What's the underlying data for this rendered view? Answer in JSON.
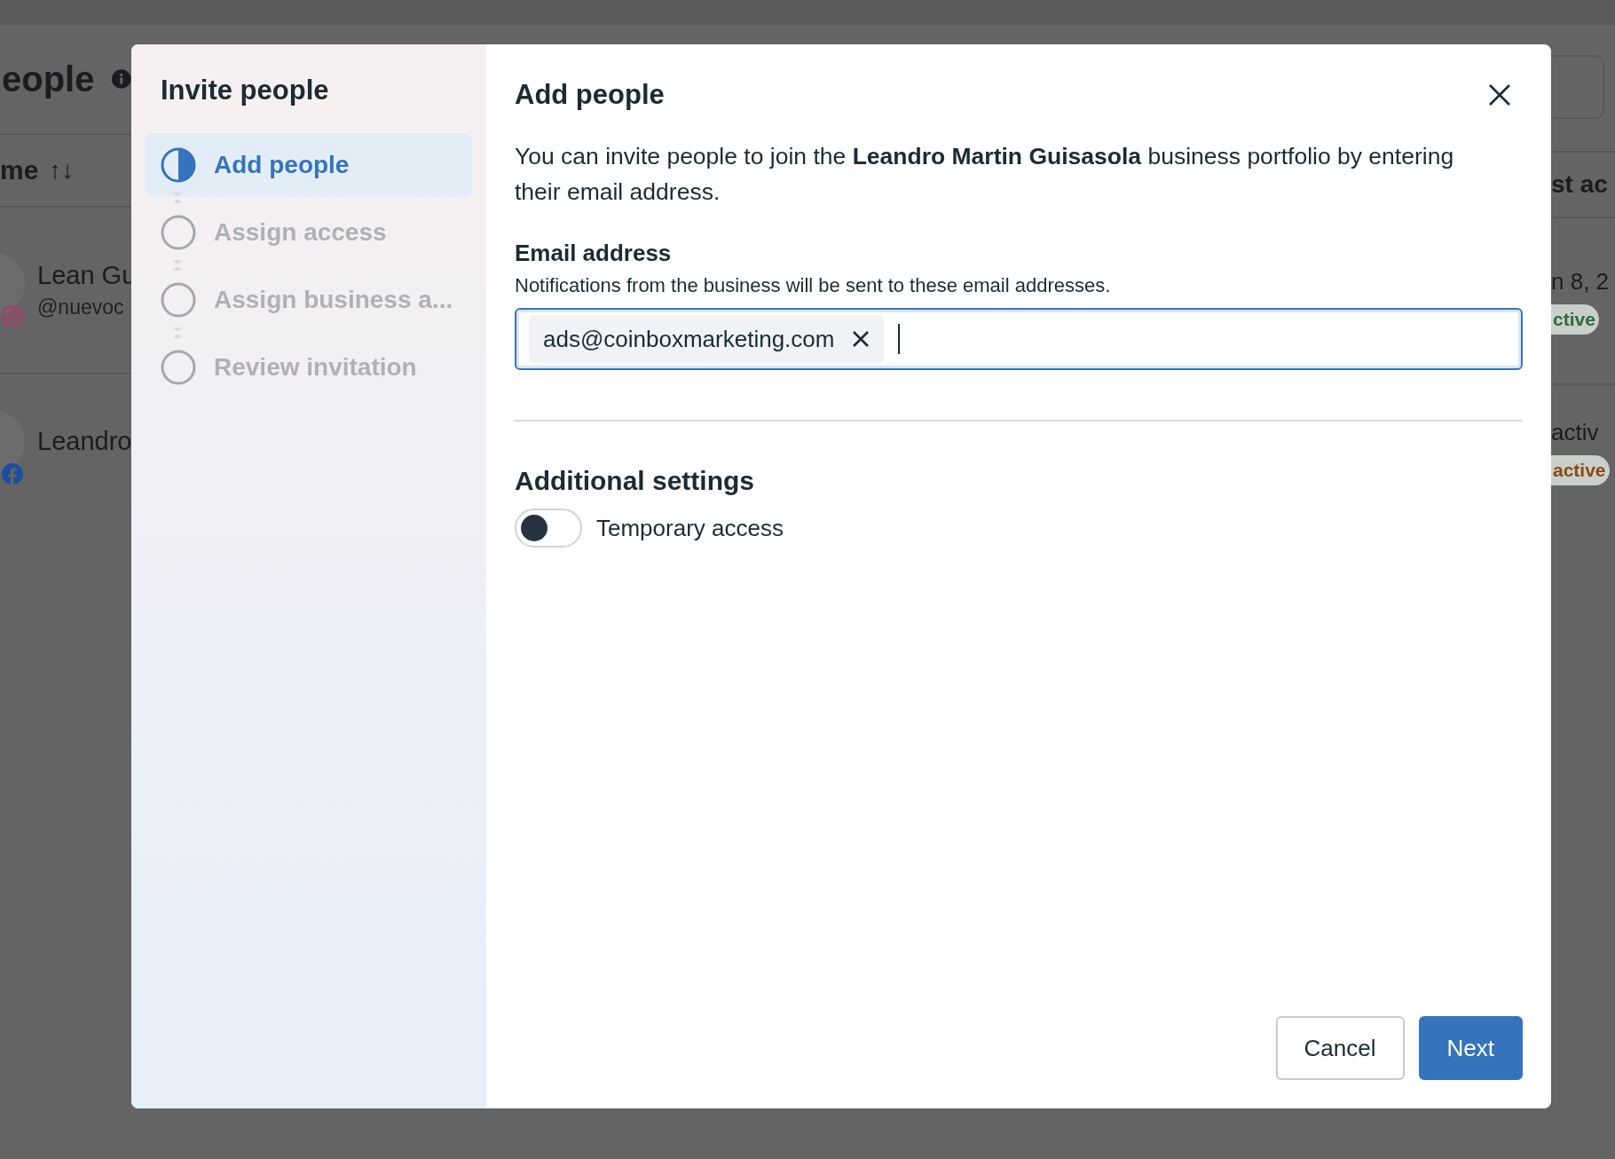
{
  "background": {
    "heading": "eople",
    "column_1": {
      "label": "me",
      "sort": "↑↓"
    },
    "column_2": "st ac",
    "rows": [
      {
        "name": "Lean Gu",
        "handle": "@nuevoc",
        "kind": "instagram",
        "column_2": "n 8, 2",
        "status": "ctive",
        "color": "#2e6b3a"
      },
      {
        "name": "Leandro",
        "kind": "facebook",
        "column_2": "activ",
        "status": "active",
        "color": "#8a4a12"
      }
    ]
  },
  "dialog": {
    "sidebar": {
      "title": "Invite people",
      "steps": [
        {
          "label": "Add people",
          "selected": true
        },
        {
          "label": "Assign access",
          "selected": false
        },
        {
          "label": "Assign business a...",
          "selected": false
        },
        {
          "label": "Review invitation",
          "selected": false
        }
      ]
    },
    "title": "Add people",
    "intro": "You can invite people to join the **Leandro Martin Guisasola** business portfolio by entering their email address.",
    "email": {
      "label": "Email address",
      "hint": "Notifications from the business will be sent to these email addresses.",
      "entries": [
        "ads@coinboxmarketing.com"
      ]
    },
    "settings": {
      "title": "Additional settings",
      "toggles": [
        {
          "label": "Temporary access",
          "on": false
        }
      ]
    },
    "buttons": [
      {
        "label": "Cancel",
        "kind": "secondary"
      },
      {
        "label": "Next",
        "kind": "primary"
      }
    ]
  }
}
